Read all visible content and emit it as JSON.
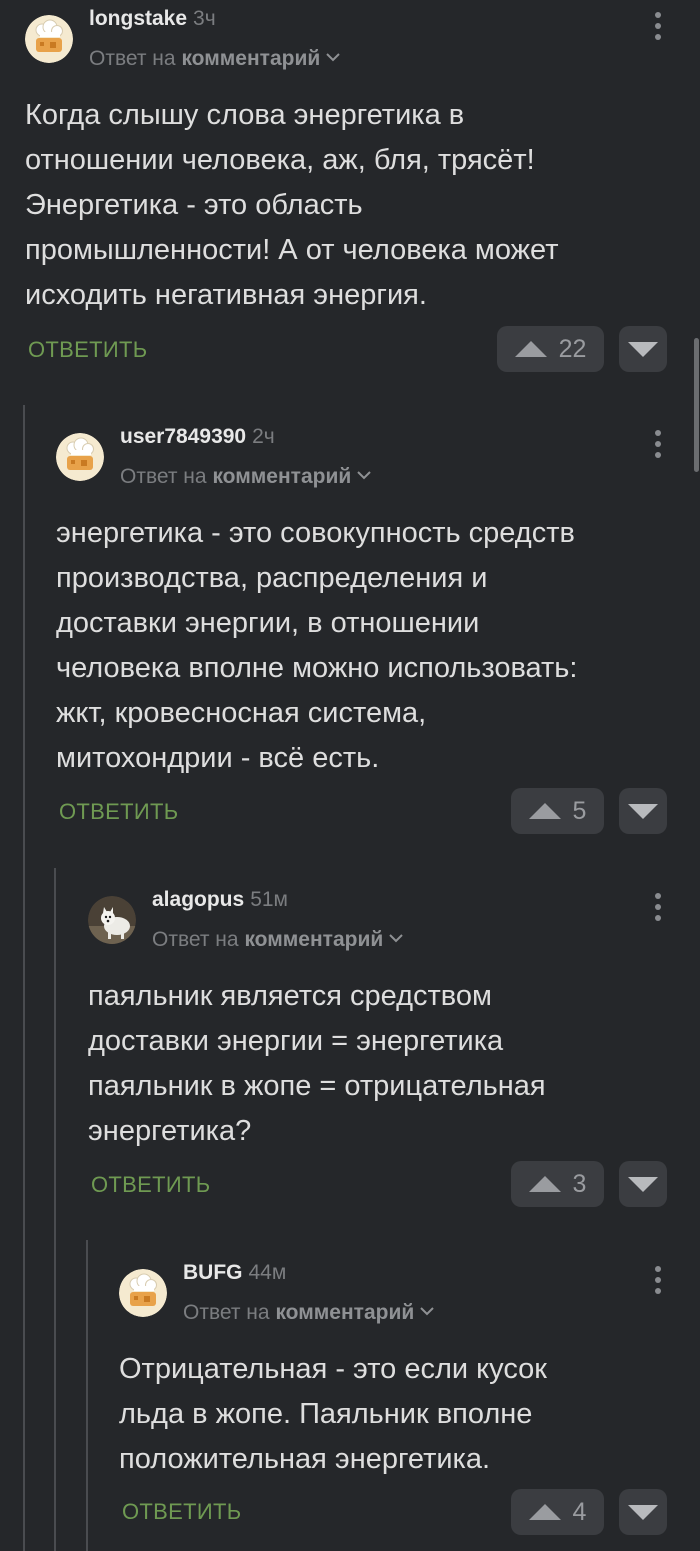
{
  "comments": [
    {
      "author": "longstake",
      "time": "3ч",
      "reply_prefix": "Ответ на",
      "reply_target": "комментарий",
      "text": "Когда слышу слова энергетика в\nотношении человека, аж, бля, трясёт!\nЭнергетика - это область\nпромышленности! А от человека может\nисходить негативная энергия.",
      "reply_label": "ОТВЕТИТЬ",
      "rating": "22",
      "avatar_icon": "chef-hat-avatar-icon"
    },
    {
      "author": "user7849390",
      "time": "2ч",
      "reply_prefix": "Ответ на",
      "reply_target": "комментарий",
      "text": "энергетика - это совокупность средств\nпроизводства, распределения и\nдоставки энергии, в отношении\nчеловека вполне можно использовать:\nжкт, кровесносная система,\nмитохондрии - всё есть.",
      "reply_label": "ОТВЕТИТЬ",
      "rating": "5",
      "avatar_icon": "chef-hat-avatar-icon"
    },
    {
      "author": "alagopus",
      "time": "51м",
      "reply_prefix": "Ответ на",
      "reply_target": "комментарий",
      "text": "паяльник является средством\nдоставки энергии = энергетика\nпаяльник в жопе = отрицательная\nэнергетика?",
      "reply_label": "ОТВЕТИТЬ",
      "rating": "3",
      "avatar_icon": "arctic-fox-photo-avatar"
    },
    {
      "author": "BUFG",
      "time": "44м",
      "reply_prefix": "Ответ на",
      "reply_target": "комментарий",
      "text": "Отрицательная - это если кусок\nльда в жопе. Паяльник вполне\nположительная энергетика.",
      "reply_label": "ОТВЕТИТЬ",
      "rating": "4",
      "avatar_icon": "chef-hat-avatar-icon"
    }
  ],
  "colors": {
    "background": "#25272a",
    "accent_green": "#6f9a52",
    "button_bg": "#3b3d41",
    "thread_line": "#4a4c50"
  }
}
